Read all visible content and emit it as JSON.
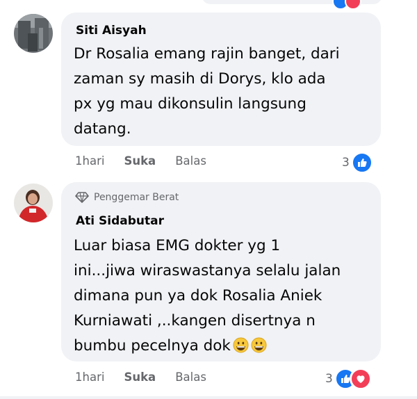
{
  "comments": [
    {
      "author": "Siti Aisyah",
      "lines": [
        "Dr Rosalia emang rajin banget, dari",
        "zaman sy masih di Dorys, klo ada",
        "px yg mau dikonsulin langsung",
        "datang."
      ],
      "time": "1hari",
      "like_label": "Suka",
      "reply_label": "Balas",
      "reaction_count": "3",
      "reactions": [
        "like-icon"
      ]
    },
    {
      "badge": "Penggemar Berat",
      "author": "Ati Sidabutar",
      "lines": [
        "Luar biasa EMG dokter yg 1",
        "ini...jiwa wiraswastanya selalu jalan",
        "dimana pun ya dok Rosalia Aniek",
        "Kurniawati ,..kangen disertnya n",
        "bumbu pecelnya dok"
      ],
      "trailing_emojis": [
        "grinning-face-emoji",
        "grinning-face-emoji"
      ],
      "time": "1hari",
      "like_label": "Suka",
      "reply_label": "Balas",
      "reaction_count": "3",
      "reactions": [
        "like-icon",
        "love-icon"
      ]
    }
  ],
  "colors": {
    "bubble": "#f0f2f5",
    "meta_text": "#65676b",
    "like_blue": "#1877f2",
    "love_red": "#f33e58"
  }
}
